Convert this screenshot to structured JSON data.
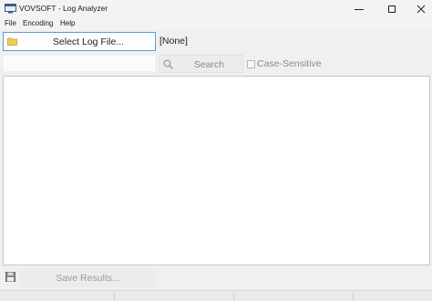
{
  "window": {
    "title": "VOVSOFT - Log Analyzer",
    "icons": {
      "app": "app-window-icon",
      "minimize": "minimize-icon",
      "maximize": "maximize-icon",
      "close": "close-icon"
    }
  },
  "menu": {
    "items": [
      {
        "label": "File"
      },
      {
        "label": "Encoding"
      },
      {
        "label": "Help"
      }
    ]
  },
  "toolbar": {
    "select_label": "Select Log File...",
    "select_icon": "folder-icon",
    "file_status": "[None]"
  },
  "search": {
    "value": "",
    "button_label": "Search",
    "button_icon": "magnifier-icon",
    "case_label": "Case-Sensitive",
    "case_checked": false
  },
  "results": {
    "content": ""
  },
  "footer": {
    "save_label": "Save Results...",
    "save_icon": "floppy-disk-icon"
  },
  "statusbar": {
    "panels": [
      "",
      "",
      "",
      ""
    ]
  },
  "colors": {
    "accent": "#5a9fd4",
    "window_bg": "#f0f0f0",
    "disabled_text": "#8a8a8a"
  }
}
